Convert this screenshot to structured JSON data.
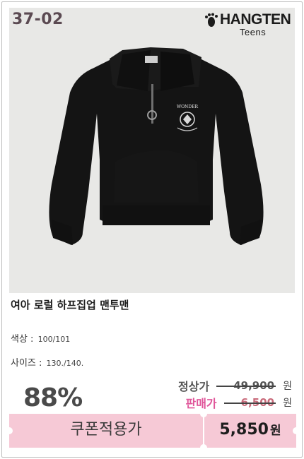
{
  "product": {
    "code": "37-02",
    "name": "여아 로럴 하프집업 맨투맨",
    "image_icon": "black-half-zip-sweatshirt",
    "emblem_text": "WONDER"
  },
  "brand": {
    "name": "HANGTEN",
    "sub": "Teens",
    "logo_icon": "footprint-icon"
  },
  "options": {
    "color_label": "색상 :",
    "color_value": "100/101",
    "size_label": "사이즈 :",
    "size_value": "130./140."
  },
  "pricing": {
    "discount": "88%",
    "regular_label": "정상가",
    "regular_price": "49,900",
    "sale_label": "판매가",
    "sale_price": "6,500",
    "currency": "원"
  },
  "coupon": {
    "label": "쿠폰적용가",
    "price": "5,850",
    "currency": "원"
  },
  "colors": {
    "accent_pink": "#e0569a",
    "coupon_bg": "#f6c9d6",
    "photo_bg": "#e8e8e6",
    "code_color": "#5b4a52"
  }
}
